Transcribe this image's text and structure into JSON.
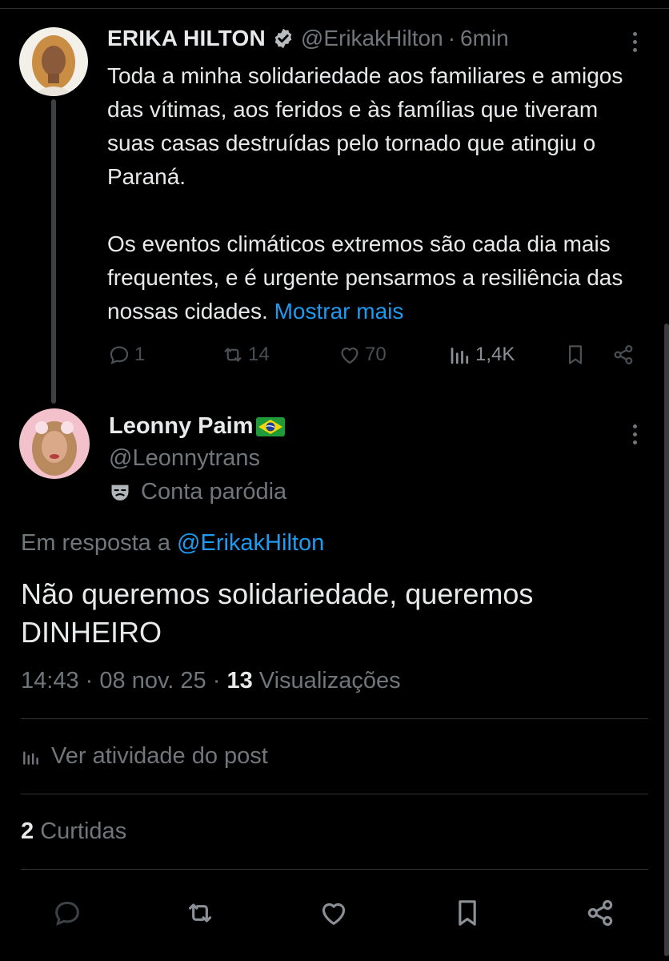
{
  "parent": {
    "name": "ERIKA HILTON",
    "handle": "@ErikakHilton",
    "separator": "·",
    "time": "6min",
    "paragraph1": "Toda a minha solidariedade aos familiares e amigos das vítimas, aos feridos e às famílias que tiveram suas casas destruídas pelo tornado que atingiu o Paraná.",
    "paragraph2": "Os eventos climáticos extremos são cada dia mais frequentes, e é urgente pensarmos a resiliência das nossas cidades.",
    "show_more": "Mostrar mais",
    "stats": {
      "replies": "1",
      "reposts": "14",
      "likes": "70",
      "views": "1,4K"
    }
  },
  "reply": {
    "name": "Leonny Paim",
    "handle": "@Leonnytrans",
    "parody_label": "Conta paródia",
    "reply_prefix": "Em resposta a",
    "reply_to": "@ErikakHilton",
    "text": "Não queremos solidariedade, queremos DINHEIRO",
    "time": "14:43",
    "date": "08 nov. 25",
    "meta_sep": "·",
    "views_count": "13",
    "views_label": "Visualizações",
    "activity_label": "Ver atividade do post",
    "likes_count": "2",
    "likes_label": "Curtidas"
  },
  "icons": [
    "verified-icon",
    "more-icon",
    "reply-icon",
    "repost-icon",
    "like-icon",
    "views-icon",
    "bookmark-icon",
    "share-icon",
    "parody-mask-icon",
    "brazil-flag-icon"
  ],
  "colors": {
    "background": "#000000",
    "text": "#e7e9ea",
    "secondary": "#71767b",
    "link": "#1d9bf0",
    "divider": "#2f3336"
  }
}
